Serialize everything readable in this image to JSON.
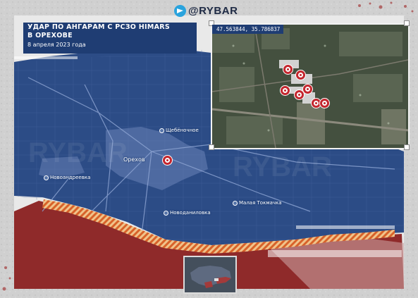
{
  "brand": {
    "handle": "@RYBAR",
    "icon": "telegram-icon"
  },
  "title": {
    "line1": "УДАР ПО АНГАРАМ С РСЗО HIMARS",
    "line2": "В ОРЕХОВЕ",
    "date": "8 апреля 2023 года"
  },
  "inset": {
    "coordinates": "47.563844, 35.786837",
    "strike_markers": 7
  },
  "places": [
    {
      "name": "Орехов",
      "role": "strike"
    },
    {
      "name": "Щебёночное",
      "role": "settlement"
    },
    {
      "name": "Новоандреевка",
      "role": "settlement"
    },
    {
      "name": "Новоданиловка",
      "role": "settlement"
    },
    {
      "name": "Малая Токмачка",
      "role": "settlement"
    }
  ],
  "colors": {
    "ukraine_control": "#2c4c86",
    "russia_control": "#8f2a2a",
    "front_line": "#e07b2a",
    "title_bg": "#1f3d73",
    "strike_marker": "#c4262e"
  },
  "watermark": "RYBAR"
}
